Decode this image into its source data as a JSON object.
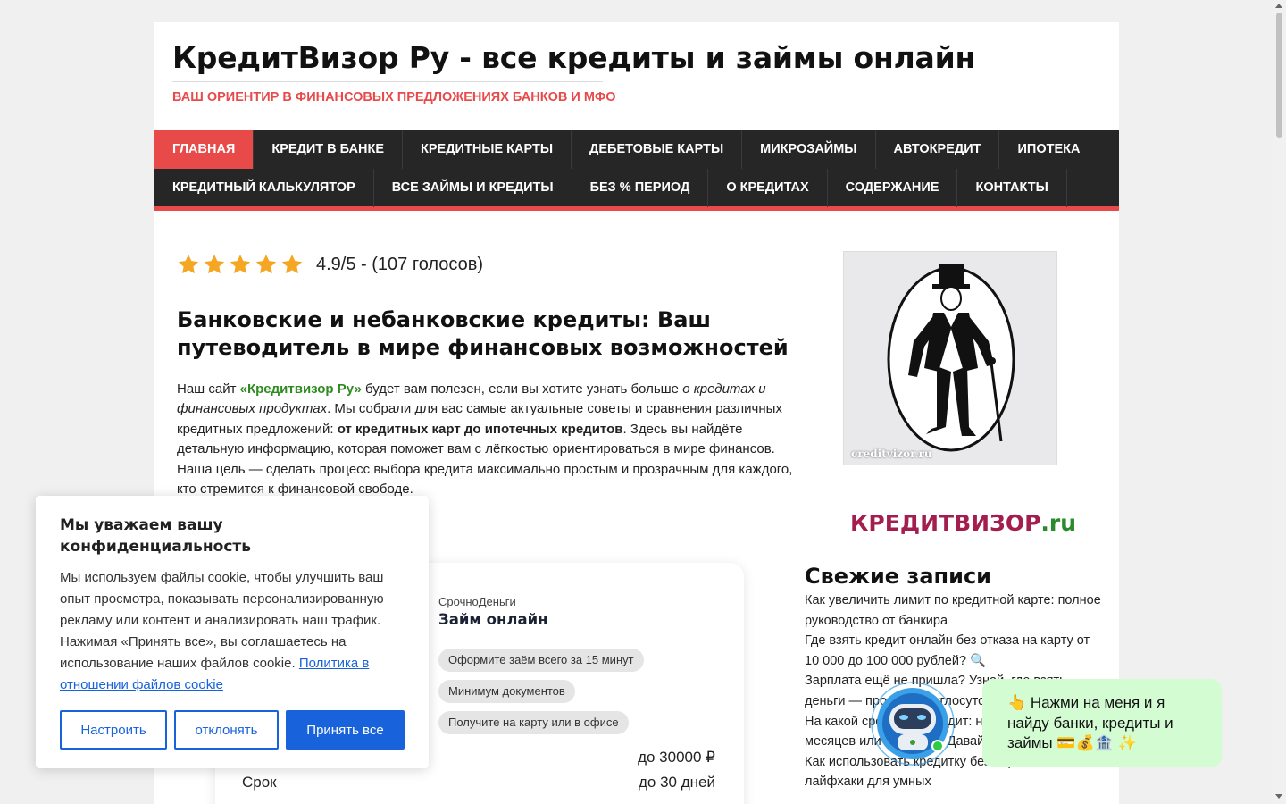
{
  "site": {
    "title": "КредитВизор Ру - все кредиты и займы онлайн",
    "tagline": "ВАШ ОРИЕНТИР В ФИНАНСОВЫХ ПРЕДЛОЖЕНИЯХ БАНКОВ И МФО"
  },
  "nav": {
    "row1": [
      "ГЛАВНАЯ",
      "КРЕДИТ В БАНКЕ",
      "КРЕДИТНЫЕ КАРТЫ",
      "ДЕБЕТОВЫЕ КАРТЫ",
      "МИКРОЗАЙМЫ",
      "АВТОКРЕДИТ",
      "ИПОТЕКА"
    ],
    "row2": [
      "КРЕДИТНЫЙ КАЛЬКУЛЯТОР",
      "ВСЕ ЗАЙМЫ И КРЕДИТЫ",
      "БЕЗ % ПЕРИОД",
      "О КРЕДИТАХ",
      "СОДЕРЖАНИЕ",
      "КОНТАКТЫ"
    ],
    "active": "ГЛАВНАЯ"
  },
  "rating": {
    "stars": 5,
    "score": 4.9,
    "text": "4.9/5 - (107 голосов)"
  },
  "article": {
    "heading": "Банковские и небанковские кредиты: Ваш путеводитель в мире финансовых возможностей",
    "intro_1": "Наш сайт ",
    "intro_brand": "«Кредитвизор Ру»",
    "intro_2": " будет вам полезен, если вы хотите узнать больше ",
    "intro_italic": "о кредитах и финансовых продуктах",
    "intro_3": ". Мы собрали для вас самые актуальные советы и сравнения различных кредитных предложений: ",
    "intro_bold": "от кредитных карт до ипотечных кредитов",
    "intro_4": ". Здесь вы найдёте детальную информацию, которая поможет вам с лёгкостью ориентироваться в мире финансов. Наша цель — сделать процесс выбора кредита максимально простым и прозрачным для каждого, кто стремится к финансовой свободе."
  },
  "offer": {
    "company": "СрочноДеньги",
    "name": "Займ онлайн",
    "tags": [
      "Оформите заём всего за 15 минут",
      "Минимум документов",
      "Получите на карту или в офисе"
    ],
    "amount_value": "до 30000 ₽",
    "term_label": "Срок",
    "term_value": "до 30 дней"
  },
  "sidebar": {
    "image_watermark": "creditvizor.ru",
    "logo_main": "КРЕДИТВИЗОР",
    "logo_suffix": ".ru",
    "fresh_heading": "Свежие записи",
    "fresh_items": [
      "Как увеличить лимит по кредитной карте: полное руководство от банкира",
      "Где взять кредит онлайн без отказа на карту от 10 000 до 100 000 рублей? 🔍",
      "Зарплата ещё не пришла? Узнай, где взять деньги — просто и круглосуточно",
      "На какой срок взять кредит: на несколько месяцев или пару лет? Давайте разберёмся",
      "Как использовать кредитку без переплат: лайфхаки для умных"
    ]
  },
  "cookie": {
    "title": "Мы уважаем вашу конфиденциальность",
    "text": "Мы используем файлы cookie, чтобы улучшить ваш опыт просмотра, показывать персонализированную рекламу или контент и анализировать наш трафик. Нажимая «Принять все», вы соглашаетесь на использование наших файлов cookie.",
    "link": "Политика в отношении файлов cookie",
    "btn_customize": "Настроить",
    "btn_reject": "отклонять",
    "btn_accept": "Принять все"
  },
  "chat": {
    "bubble": "👆 Нажми на меня и я найду банки, кредиты и займы 💳💰🏦 ✨"
  },
  "colors": {
    "accent": "#e84a4a",
    "nav_bg": "#262626",
    "brand_green": "#2e8b1f",
    "logo_main": "#a31d4f",
    "cookie_blue": "#1863dc",
    "chat_bubble": "#d3fcd3",
    "star": "#f5a623"
  },
  "icons": {
    "star": "star-icon",
    "chat_bot": "robot-icon",
    "online_status": "online-dot-icon"
  }
}
